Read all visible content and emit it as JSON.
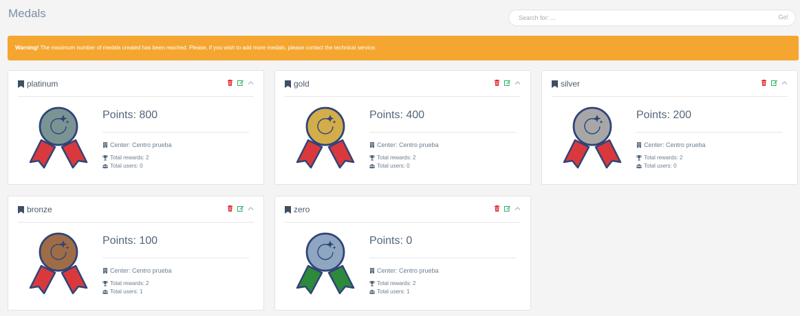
{
  "page": {
    "title": "Medals"
  },
  "search": {
    "placeholder": "Search for: ...",
    "go_label": "Go!"
  },
  "warning": {
    "strong": "Warning!",
    "text": " The maximum number of medals created has been reached. Please, if you wish to add more medals, please contact the technical service."
  },
  "labels": {
    "points_prefix": "Points: ",
    "center_prefix": "Center: ",
    "rewards_prefix": "Total rewards: ",
    "users_prefix": "Total users: "
  },
  "colors": {
    "warning_bg": "#f4a630",
    "delete_icon": "#e3262d",
    "edit_icon": "#27ae60",
    "ribbon_red": "#d9393d",
    "ribbon_green": "#2d8a3a",
    "medal_outline": "#2f4477"
  },
  "medals": [
    {
      "name": "platinum",
      "points": "Points: 800",
      "center": "Center: Centro prueba",
      "rewards": "Total rewards: 2",
      "users": "Total users: 0",
      "disc_color": "#7a9494",
      "ribbon_color": "#d9393d"
    },
    {
      "name": "gold",
      "points": "Points: 400",
      "center": "Center: Centro prueba",
      "rewards": "Total rewards: 2",
      "users": "Total users: 0",
      "disc_color": "#d3ad4b",
      "ribbon_color": "#d9393d"
    },
    {
      "name": "silver",
      "points": "Points: 200",
      "center": "Center: Centro prueba",
      "rewards": "Total rewards: 2",
      "users": "Total users: 0",
      "disc_color": "#a7a7a8",
      "ribbon_color": "#d9393d"
    },
    {
      "name": "bronze",
      "points": "Points: 100",
      "center": "Center: Centro prueba",
      "rewards": "Total rewards: 2",
      "users": "Total users: 1",
      "disc_color": "#9e6d47",
      "ribbon_color": "#d9393d"
    },
    {
      "name": "zero",
      "points": "Points: 0",
      "center": "Center: Centro prueba",
      "rewards": "Total rewards: 2",
      "users": "Total users: 1",
      "disc_color": "#8ea6c1",
      "ribbon_color": "#2d8a3a"
    }
  ],
  "icons": {
    "title": "bookmark-icon",
    "delete": "trash-icon",
    "edit": "edit-icon",
    "collapse": "chevron-up-icon",
    "center": "building-icon",
    "rewards": "trophy-icon",
    "users": "users-icon"
  }
}
